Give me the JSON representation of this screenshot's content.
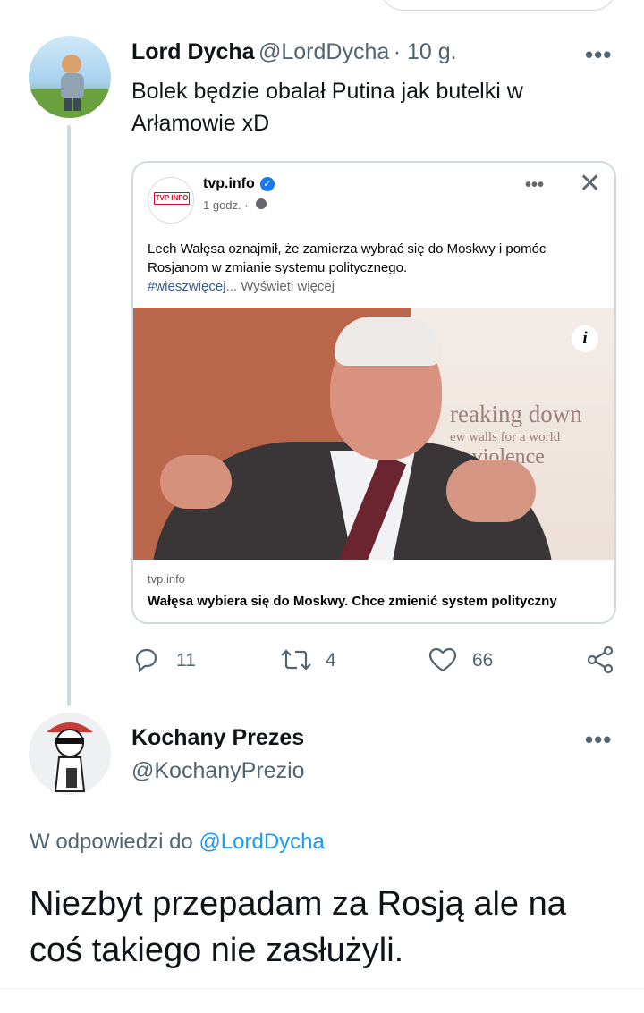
{
  "tweet1": {
    "author_name": "Lord Dycha",
    "author_handle": "@LordDycha",
    "time": "· 10 g.",
    "more_label": "•••",
    "text": "Bolek będzie obalał Putina jak butelki w Arłamowie xD"
  },
  "fb_card": {
    "logo_text": "TVP INFO",
    "page_name": "tvp.info",
    "verified_icon": "verified-check-icon",
    "time": "1 godz. ·",
    "more_label": "•••",
    "close_label": "✕",
    "post_text": "Lech Wałęsa oznajmił, że zamierza wybrać się do Moskwy i pomóc Rosjanom w zmianie systemu politycznego.",
    "hashtag": "#wieszwięcej",
    "see_more": "... Wyświetl więcej",
    "image_text_1": "reaking down",
    "image_text_2": "ew walls for a world",
    "image_text_3": "ut violence",
    "info_label": "i",
    "link_domain": "tvp.info",
    "link_title": "Wałęsa wybiera się do Moskwy. Chce zmienić system polityczny"
  },
  "actions": {
    "reply_count": "11",
    "retweet_count": "4",
    "like_count": "66"
  },
  "tweet2": {
    "author_name": "Kochany Prezes",
    "author_handle": "@KochanyPrezio",
    "more_label": "•••",
    "reply_prefix": "W odpowiedzi do ",
    "reply_mention": "@LordDycha",
    "text": "Niezbyt przepadam za Rosją ale na coś takiego nie zasłużyli."
  },
  "colors": {
    "accent": "#1d9bf0",
    "secondary_text": "#536471",
    "border": "#cfd9de"
  }
}
